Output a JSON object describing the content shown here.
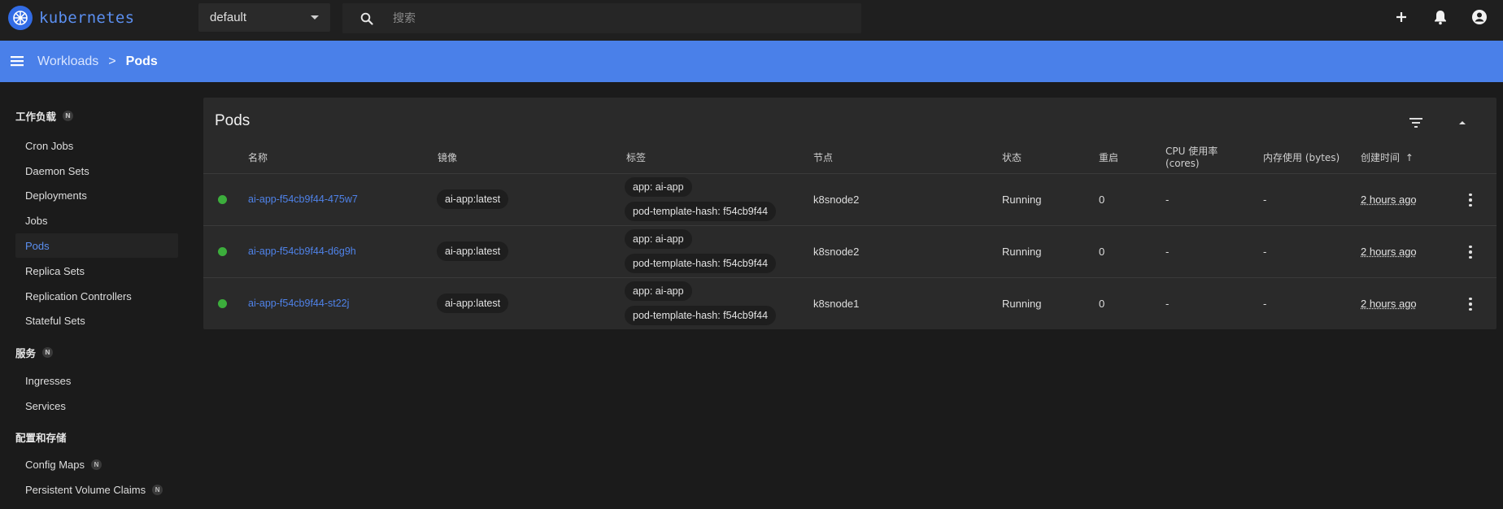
{
  "app": {
    "brand": "kubernetes"
  },
  "toolbar": {
    "namespace": "default",
    "search_placeholder": "搜索"
  },
  "breadcrumb": {
    "parent": "Workloads",
    "separator": ">",
    "current": "Pods"
  },
  "sidebar": {
    "sections": [
      {
        "title": "工作负载",
        "badge": "N"
      },
      {
        "title": "服务",
        "badge": "N"
      },
      {
        "title": "配置和存储",
        "badge": ""
      }
    ],
    "workload_items": [
      "Cron Jobs",
      "Daemon Sets",
      "Deployments",
      "Jobs",
      "Pods",
      "Replica Sets",
      "Replication Controllers",
      "Stateful Sets"
    ],
    "service_items": [
      "Ingresses",
      "Services"
    ],
    "config_items": [
      {
        "label": "Config Maps",
        "badge": "N"
      },
      {
        "label": "Persistent Volume Claims",
        "badge": "N"
      }
    ],
    "active_item": "Pods"
  },
  "card": {
    "title": "Pods",
    "columns": {
      "name": "名称",
      "image": "镜像",
      "labels": "标签",
      "node": "节点",
      "status": "状态",
      "restarts": "重启",
      "cpu_line1": "CPU 使用率",
      "cpu_line2": "(cores)",
      "memory": "内存使用 (bytes)",
      "created": "创建时间",
      "sort_arrow": "↑"
    },
    "rows": [
      {
        "name": "ai-app-f54cb9f44-475w7",
        "image": "ai-app:latest",
        "label1": "app: ai-app",
        "label2": "pod-template-hash: f54cb9f44",
        "node": "k8snode2",
        "status": "Running",
        "restarts": "0",
        "cpu": "-",
        "memory": "-",
        "created": "2 hours ago"
      },
      {
        "name": "ai-app-f54cb9f44-d6g9h",
        "image": "ai-app:latest",
        "label1": "app: ai-app",
        "label2": "pod-template-hash: f54cb9f44",
        "node": "k8snode2",
        "status": "Running",
        "restarts": "0",
        "cpu": "-",
        "memory": "-",
        "created": "2 hours ago"
      },
      {
        "name": "ai-app-f54cb9f44-st22j",
        "image": "ai-app:latest",
        "label1": "app: ai-app",
        "label2": "pod-template-hash: f54cb9f44",
        "node": "k8snode1",
        "status": "Running",
        "restarts": "0",
        "cpu": "-",
        "memory": "-",
        "created": "2 hours ago"
      }
    ]
  },
  "colors": {
    "header_blue": "#4a80e9",
    "link_blue": "#4f82e8",
    "status_running": "#3cae3c",
    "background": "#1b1b1b",
    "card": "#2a2a2a"
  }
}
